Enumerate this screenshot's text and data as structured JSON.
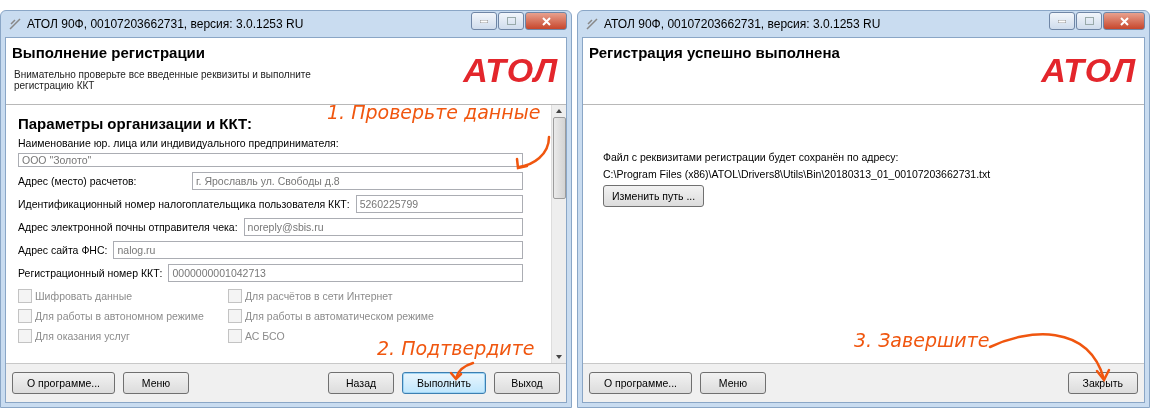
{
  "windows": [
    {
      "kind": "form",
      "title": "АТОЛ 90Ф, 00107203662731, версия: 3.0.1253 RU",
      "header": {
        "title": "Выполнение регистрации",
        "subtitle": "Внимательно проверьте все введенные реквизиты и выполните регистрацию ККТ",
        "logo": "АТОЛ"
      },
      "section_title": "Параметры организации и ККТ:",
      "fields": [
        {
          "kind": "stacked",
          "label": "Наименование юр. лица или индивидуального предпринимателя:",
          "value": "ООО \"Золото\""
        },
        {
          "kind": "wide",
          "label": "Адрес (место) расчетов:",
          "value": "г. Ярославль ул. Свободы д.8"
        },
        {
          "kind": "inline",
          "label": "Идентификационный номер налогоплательщика пользователя ККТ:",
          "value": "5260225799"
        },
        {
          "kind": "inline",
          "label": "Адрес электронной почны отправителя чека:",
          "value": "noreply@sbis.ru"
        },
        {
          "kind": "inline",
          "label": "Адрес сайта ФНС:",
          "value": "nalog.ru"
        },
        {
          "kind": "inline",
          "label": "Регистрационный номер ККТ:",
          "value": "0000000001042713"
        }
      ],
      "checkboxes": [
        {
          "label": "Шифровать данные",
          "checked": false,
          "disabled": true
        },
        {
          "label": "Для расчётов в сети Интернет",
          "checked": false,
          "disabled": true
        },
        {
          "label": "Для работы в автономном режиме",
          "checked": false,
          "disabled": true
        },
        {
          "label": "Для работы в автоматическом режиме",
          "checked": false,
          "disabled": true
        },
        {
          "label": "Для оказания услуг",
          "checked": false,
          "disabled": true
        },
        {
          "label": "АС БСО",
          "checked": false,
          "disabled": true
        }
      ],
      "footer": {
        "left_buttons": [
          {
            "label": "О программе...",
            "focused": false
          },
          {
            "label": "Меню",
            "focused": false
          }
        ],
        "right_buttons": [
          {
            "label": "Назад",
            "focused": false
          },
          {
            "label": "Выполнить",
            "focused": true
          },
          {
            "label": "Выход",
            "focused": false
          }
        ]
      },
      "annotations": [
        {
          "kind": "check",
          "text": "1. Проверьте данные"
        },
        {
          "kind": "confirm",
          "text": "2. Подтвердите"
        }
      ]
    },
    {
      "kind": "result",
      "title": "АТОЛ 90Ф, 00107203662731, версия: 3.0.1253 RU",
      "header": {
        "title": "Регистрация успешно выполнена",
        "logo": "АТОЛ"
      },
      "message": "Файл с реквизитами регистрации будет сохранён по адресу:",
      "path": "C:\\Program Files (x86)\\ATOL\\Drivers8\\Utils\\Bin\\20180313_01_00107203662731.txt",
      "change_button": "Изменить путь ...",
      "footer": {
        "left_buttons": [
          {
            "label": "О программе...",
            "focused": false
          },
          {
            "label": "Меню",
            "focused": false
          }
        ],
        "right_buttons": [
          {
            "label": "Закрыть",
            "focused": false
          }
        ]
      },
      "annotations": [
        {
          "kind": "finish",
          "text": "3. Завершите"
        }
      ]
    }
  ]
}
